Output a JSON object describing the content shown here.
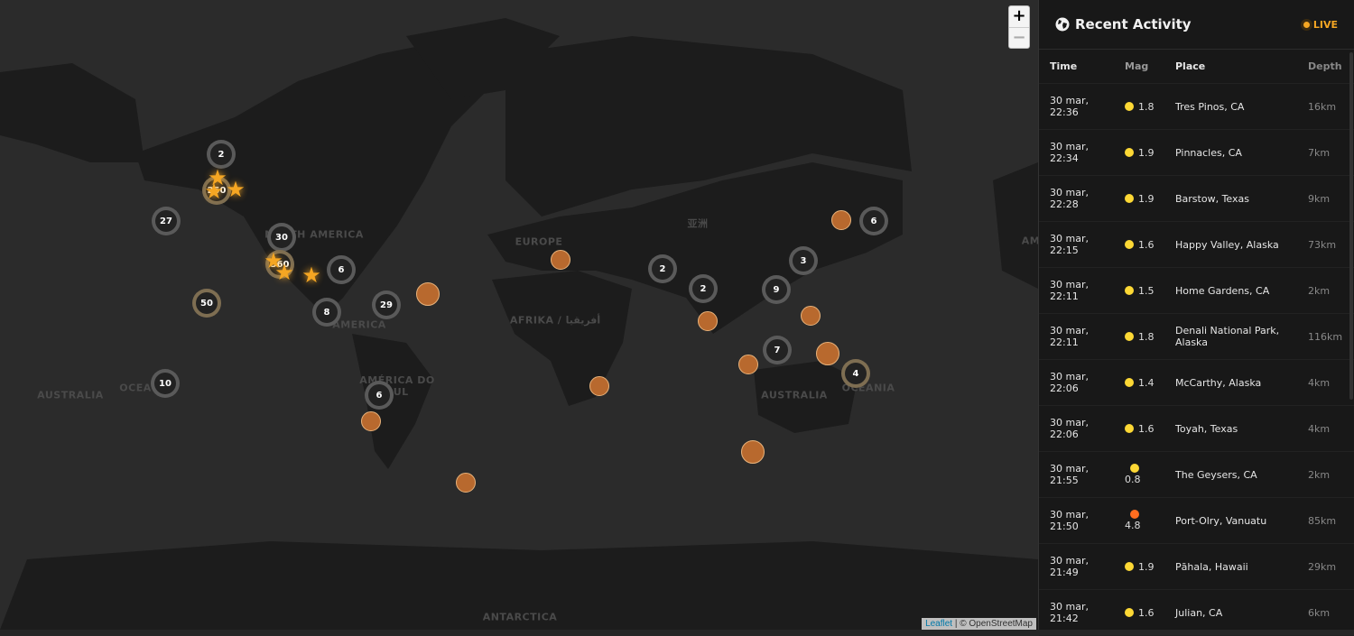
{
  "map": {
    "labels": [
      "NORTH AMERICA",
      "EUROPE",
      "亚洲",
      "AFRIKA / أفريقيا",
      "AMERICA",
      "AMÉRICA DO SUL",
      "AUSTRALIA",
      "OCEA",
      "AUSTRALIA",
      "OCEANIA",
      "ANTARCTICA",
      "AM"
    ],
    "clusters": [
      "2",
      "250",
      "27",
      "30",
      "360",
      "6",
      "50",
      "8",
      "29",
      "10",
      "6",
      "2",
      "2",
      "3",
      "9",
      "7",
      "4",
      "6"
    ],
    "zoom_in": "+",
    "zoom_out": "−",
    "attribution": {
      "leaflet": "Leaflet",
      "osm": "| © OpenStreetMap"
    }
  },
  "panel": {
    "title": "Recent Activity",
    "title_icon": "globe-icon",
    "live": "LIVE",
    "accent": "#f5a623",
    "columns": [
      "Time",
      "Mag",
      "Place",
      "Depth"
    ],
    "colors": {
      "minor": "#fdd835",
      "moderate": "#ff6d1f"
    },
    "rows": [
      {
        "date": "30 mar,",
        "time": "22:36",
        "mag": "1.8",
        "place": "Tres Pinos, CA",
        "depth": "16km",
        "level": "minor"
      },
      {
        "date": "30 mar,",
        "time": "22:34",
        "mag": "1.9",
        "place": "Pinnacles, CA",
        "depth": "7km",
        "level": "minor"
      },
      {
        "date": "30 mar,",
        "time": "22:28",
        "mag": "1.9",
        "place": "Barstow, Texas",
        "depth": "9km",
        "level": "minor"
      },
      {
        "date": "30 mar,",
        "time": "22:15",
        "mag": "1.6",
        "place": "Happy Valley, Alaska",
        "depth": "73km",
        "level": "minor"
      },
      {
        "date": "30 mar,",
        "time": "22:11",
        "mag": "1.5",
        "place": "Home Gardens, CA",
        "depth": "2km",
        "level": "minor"
      },
      {
        "date": "30 mar,",
        "time": "22:11",
        "mag": "1.8",
        "place": "Denali National Park, Alaska",
        "depth": "116km",
        "level": "minor"
      },
      {
        "date": "30 mar,",
        "time": "22:06",
        "mag": "1.4",
        "place": "McCarthy, Alaska",
        "depth": "4km",
        "level": "minor"
      },
      {
        "date": "30 mar,",
        "time": "22:06",
        "mag": "1.6",
        "place": "Toyah, Texas",
        "depth": "4km",
        "level": "minor"
      },
      {
        "date": "30 mar,",
        "time": "21:55",
        "mag": "0.8",
        "place": "The Geysers, CA",
        "depth": "2km",
        "level": "minor"
      },
      {
        "date": "30 mar,",
        "time": "21:50",
        "mag": "4.8",
        "place": "Port-Olry, Vanuatu",
        "depth": "85km",
        "level": "moderate"
      },
      {
        "date": "30 mar,",
        "time": "21:49",
        "mag": "1.9",
        "place": "Pāhala, Hawaii",
        "depth": "29km",
        "level": "minor"
      },
      {
        "date": "30 mar,",
        "time": "21:42",
        "mag": "1.6",
        "place": "Julian, CA",
        "depth": "6km",
        "level": "minor"
      }
    ]
  }
}
